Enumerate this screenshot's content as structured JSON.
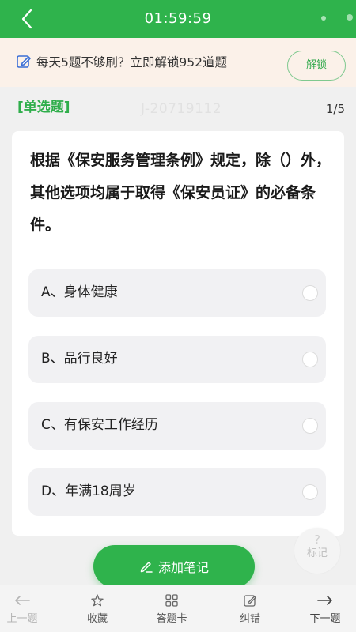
{
  "header": {
    "timer": "01:59:59"
  },
  "promo": {
    "text": "每天5题不够刷？立即解锁952道题",
    "unlock_label": "解锁"
  },
  "question_meta": {
    "type": "[单选题]",
    "id": "J-20719112",
    "progress": "1/5"
  },
  "question": {
    "text": "根据《保安服务管理条例》规定，除（）外，其他选项均属于取得《保安员证》的必备条件。",
    "options": [
      {
        "label": "A、身体健康"
      },
      {
        "label": "B、品行良好"
      },
      {
        "label": "C、有保安工作经历"
      },
      {
        "label": "D、年满18周岁"
      }
    ]
  },
  "mark": {
    "symbol": "?",
    "label": "标记"
  },
  "note_button": {
    "label": "添加笔记"
  },
  "bottom_nav": {
    "items": [
      {
        "label": "上一题",
        "icon": "arrow-left-icon"
      },
      {
        "label": "收藏",
        "icon": "star-icon"
      },
      {
        "label": "答题卡",
        "icon": "grid-icon"
      },
      {
        "label": "纠错",
        "icon": "edit-icon"
      },
      {
        "label": "下一题",
        "icon": "arrow-right-icon"
      }
    ]
  },
  "colors": {
    "primary": "#2fb34c",
    "promo_bg": "#fbf1e9",
    "option_bg": "#f1f1f3"
  }
}
